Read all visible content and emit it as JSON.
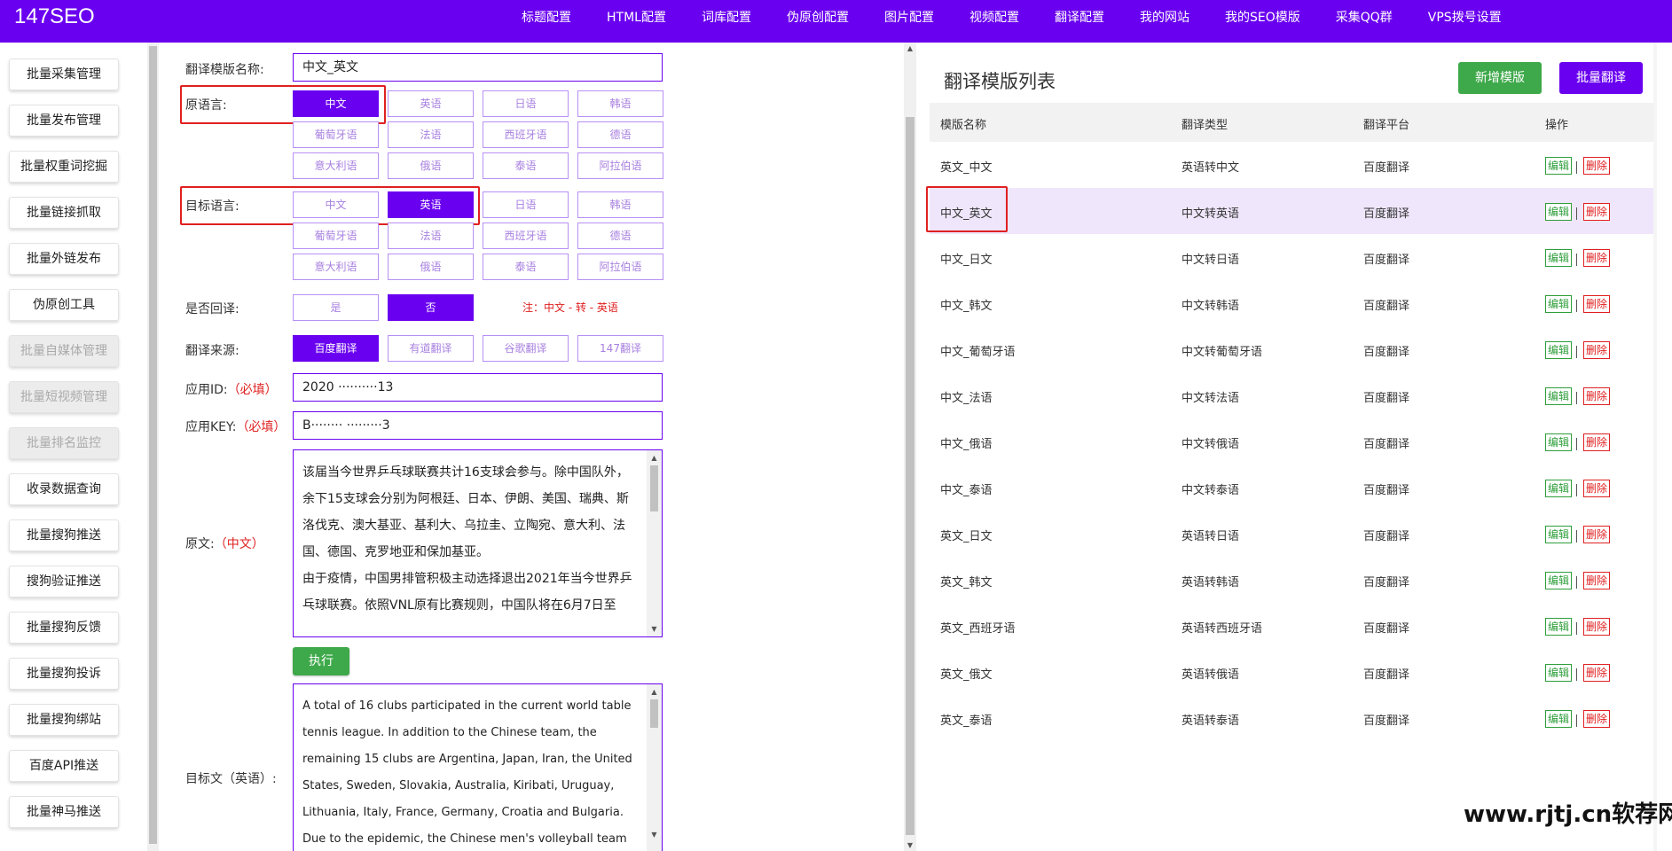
{
  "app": {
    "logo": "147SEO"
  },
  "nav": [
    "标题配置",
    "HTML配置",
    "词库配置",
    "伪原创配置",
    "图片配置",
    "视频配置",
    "翻译配置",
    "我的网站",
    "我的SEO模版",
    "采集QQ群",
    "VPS拨号设置"
  ],
  "sidebar": {
    "items": [
      "批量采集管理",
      "批量发布管理",
      "批量权重词挖掘",
      "批量链接抓取",
      "批量外链发布",
      "伪原创工具",
      "批量自媒体管理",
      "批量短视频管理",
      "批量排名监控",
      "收录数据查询",
      "批量搜狗推送",
      "搜狗验证推送",
      "批量搜狗反馈",
      "批量搜狗投诉",
      "批量搜狗绑站",
      "百度API推送",
      "批量神马推送"
    ]
  },
  "form": {
    "template_name_label": "翻译模版名称:",
    "template_name_value": "中文_英文",
    "source_lang_label": "原语言:",
    "target_lang_label": "目标语言:",
    "languages": [
      "中文",
      "英语",
      "日语",
      "韩语",
      "葡萄牙语",
      "法语",
      "西班牙语",
      "德语",
      "意大利语",
      "俄语",
      "泰语",
      "阿拉伯语"
    ],
    "source_selected": "中文",
    "target_selected": "英语",
    "back_translate_label": "是否回译:",
    "back_translate_options": [
      "是",
      "否"
    ],
    "back_translate_selected": "否",
    "note": "注：中文 - 转 - 英语",
    "source_label": "翻译来源:",
    "sources": [
      "百度翻译",
      "有道翻译",
      "谷歌翻译",
      "147翻译"
    ],
    "source_active": "百度翻译",
    "app_id_label": "应用ID:",
    "app_key_label": "应用KEY:",
    "required_mark": "（必填）",
    "app_id_value": "2020 ··········13",
    "app_key_value": "B········ ·········3",
    "original_label": "原文:",
    "original_lang": "（中文）",
    "original_text": "该届当今世界乒乓球联赛共计16支球会参与。除中国队外，余下15支球会分别为阿根廷、日本、伊朗、美国、瑞典、斯洛伐克、澳大基亚、基利大、乌拉圭、立陶宛、意大利、法国、德国、克罗地亚和保加基亚。\n由于疫情，中国男排管积极主动选择退出2021年当今世界乒乓球联赛。依照VNL原有比赛规则，中国队将在6月7日至",
    "execute_label": "执行",
    "target_label": "目标文（英语）:",
    "target_text": "A total of 16 clubs participated in the current world table tennis league. In addition to the Chinese team, the remaining 15 clubs are Argentina, Japan, Iran, the United States, Sweden, Slovakia, Australia, Kiribati, Uruguay, Lithuania, Italy, France, Germany, Croatia and Bulgaria.\nDue to the epidemic, the Chinese men's volleyball team"
  },
  "panel": {
    "title": "翻译模版列表",
    "add_button": "新增模版",
    "batch_button": "批量翻译",
    "columns": [
      "模版名称",
      "翻译类型",
      "翻译平台",
      "操作"
    ],
    "edit_label": "编辑",
    "delete_label": "删除",
    "rows": [
      {
        "name": "英文_中文",
        "type": "英语转中文",
        "platform": "百度翻译"
      },
      {
        "name": "中文_英文",
        "type": "中文转英语",
        "platform": "百度翻译"
      },
      {
        "name": "中文_日文",
        "type": "中文转日语",
        "platform": "百度翻译"
      },
      {
        "name": "中文_韩文",
        "type": "中文转韩语",
        "platform": "百度翻译"
      },
      {
        "name": "中文_葡萄牙语",
        "type": "中文转葡萄牙语",
        "platform": "百度翻译"
      },
      {
        "name": "中文_法语",
        "type": "中文转法语",
        "platform": "百度翻译"
      },
      {
        "name": "中文_俄语",
        "type": "中文转俄语",
        "platform": "百度翻译"
      },
      {
        "name": "中文_泰语",
        "type": "中文转泰语",
        "platform": "百度翻译"
      },
      {
        "name": "英文_日文",
        "type": "英语转日语",
        "platform": "百度翻译"
      },
      {
        "name": "英文_韩文",
        "type": "英语转韩语",
        "platform": "百度翻译"
      },
      {
        "name": "英文_西班牙语",
        "type": "英语转西班牙语",
        "platform": "百度翻译"
      },
      {
        "name": "英文_俄文",
        "type": "英语转俄语",
        "platform": "百度翻译"
      },
      {
        "name": "英文_泰语",
        "type": "英语转泰语",
        "platform": "百度翻译"
      }
    ],
    "highlighted_row": 1
  },
  "watermark": "www.rjtj.cn软荐网",
  "colors": {
    "accent": "#6a00f0",
    "green": "#3ea94a",
    "red": "#e02020"
  }
}
